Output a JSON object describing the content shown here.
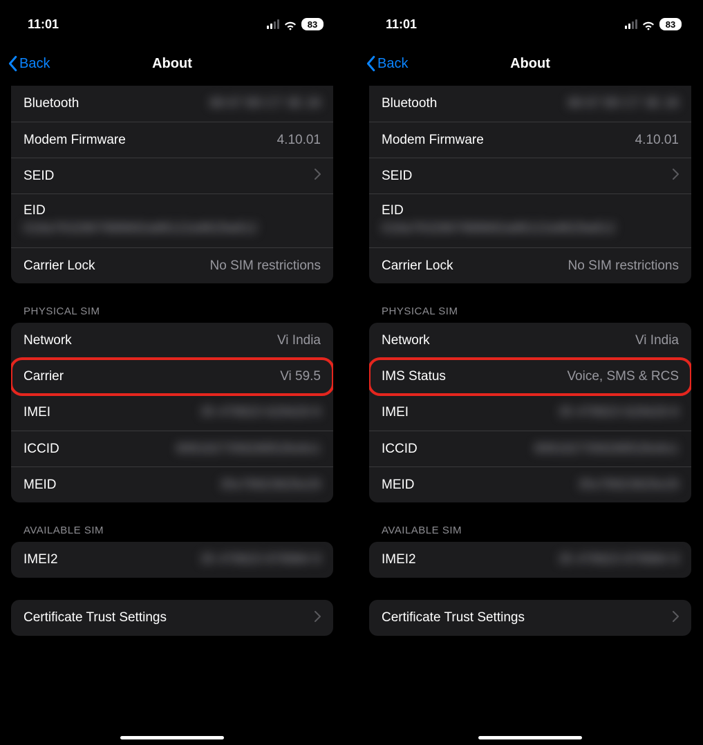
{
  "status": {
    "time": "11:01",
    "battery": "83"
  },
  "nav": {
    "back": "Back",
    "title": "About"
  },
  "group1": {
    "bluetooth_label": "Bluetooth",
    "bluetooth_value": "88 67 B5 C7 3E 28",
    "modem_label": "Modem Firmware",
    "modem_value": "4.10.01",
    "seid_label": "SEID",
    "eid_label": "EID",
    "eid_value": "018a7632867888682a88122a9629a812",
    "carrierlock_label": "Carrier Lock",
    "carrierlock_value": "No SIM restrictions"
  },
  "phys_header": "PHYSICAL SIM",
  "group2_left": {
    "network_label": "Network",
    "network_value": "Vi India",
    "carrier_label": "Carrier",
    "carrier_value": "Vi 59.5",
    "imei_label": "IMEI",
    "imei_value": "35 478923 629429 8",
    "iccid_label": "ICCID",
    "iccid_value": "8991827358288528x8x1",
    "meid_label": "MEID",
    "meid_value": "35x78923829x29"
  },
  "group2_right": {
    "network_label": "Network",
    "network_value": "Vi India",
    "ims_label": "IMS Status",
    "ims_value": "Voice,  SMS & RCS",
    "imei_label": "IMEI",
    "imei_value": "35 478923 629429 8",
    "iccid_label": "ICCID",
    "iccid_value": "8991827358288528x8x1",
    "meid_label": "MEID",
    "meid_value": "35x78923829x29"
  },
  "avail_header": "AVAILABLE SIM",
  "group3": {
    "imei2_label": "IMEI2",
    "imei2_value": "35 478923 878984 9"
  },
  "group4": {
    "cert_label": "Certificate Trust Settings"
  }
}
